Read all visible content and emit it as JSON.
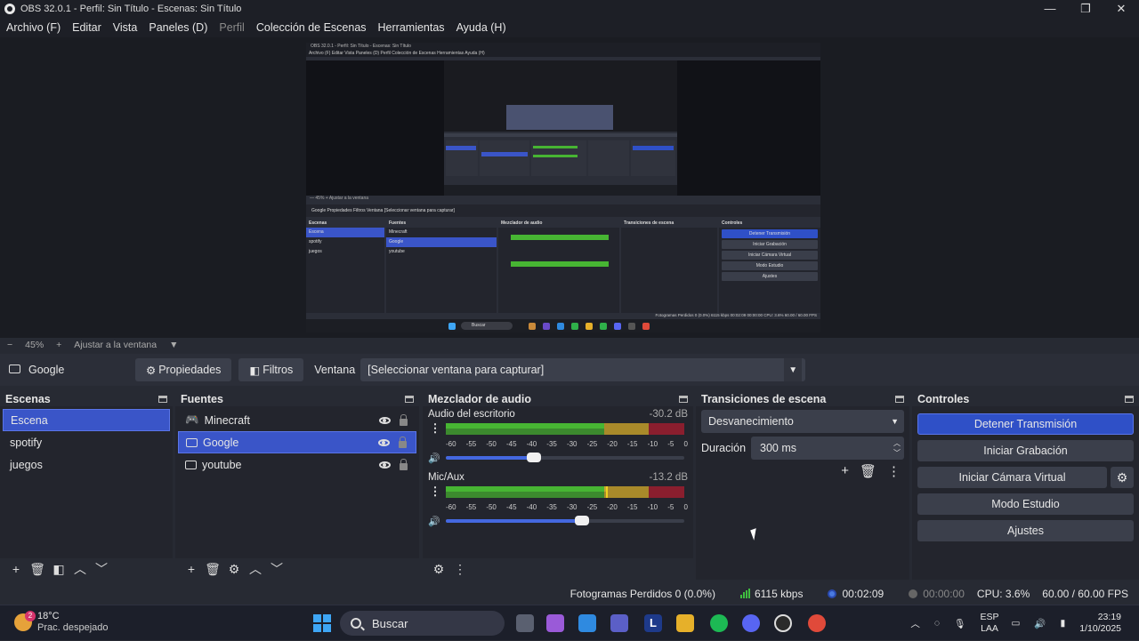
{
  "window": {
    "title": "OBS 32.0.1 - Perfil: Sin Título - Escenas: Sin Título",
    "minimize": "—",
    "maximize": "❐",
    "close": "✕"
  },
  "menu": [
    "Archivo (F)",
    "Editar",
    "Vista",
    "Paneles (D)",
    "Perfil",
    "Colección de Escenas",
    "Herramientas",
    "Ayuda (H)"
  ],
  "nested_preview": {
    "title": "OBS 32.0.1 - Perfil: Sin Título - Escenas: Sin Título",
    "menu": "Archivo (F)   Editar   Vista   Paneles (D)   Perfil   Colección de Escenas   Herramientas   Ayuda (H)",
    "zoom": "— 45%  +  Ajustar a la ventana",
    "source_bar": "Google        Propiedades   Filtros   Ventana  [Seleccionar ventana para capturar]",
    "scenes": [
      "Escena",
      "spotify",
      "juegos"
    ],
    "sources": [
      "Minecraft",
      "Google",
      "youtube"
    ],
    "controls": [
      "Detener Transmisión",
      "Iniciar Grabación",
      "Iniciar Cámara Virtual",
      "Modo Estudio",
      "Ajustes"
    ],
    "status": "Fotogramas Perdidos 0 (0.0%)   6115 kbps   00:02:09   00:00:00   CPU: 3.6%   60.00 / 60.00 FPS",
    "search": "Buscar"
  },
  "zoom": {
    "minus": "−",
    "level": "45%",
    "plus": "+",
    "fit": "Ajustar a la ventana",
    "caret": "▼"
  },
  "source_toolbar": {
    "name": "Google",
    "properties": "Propiedades",
    "filters": "Filtros",
    "window_label": "Ventana",
    "window_value": "[Seleccionar ventana para capturar]"
  },
  "scenes": {
    "title": "Escenas",
    "items": [
      "Escena",
      "spotify",
      "juegos"
    ],
    "selected": 0
  },
  "sources": {
    "title": "Fuentes",
    "items": [
      {
        "name": "Minecraft",
        "icon": "gamepad-icon"
      },
      {
        "name": "Google",
        "icon": "window-icon"
      },
      {
        "name": "youtube",
        "icon": "monitor-icon"
      }
    ],
    "selected": 1
  },
  "mixer": {
    "title": "Mezclador de audio",
    "channels": [
      {
        "name": "Audio del escritorio",
        "db": "-30.2 dB",
        "volume": 0.37
      },
      {
        "name": "Mic/Aux",
        "db": "-13.2 dB",
        "volume": 0.57
      }
    ],
    "ticks": [
      "-60",
      "-55",
      "-50",
      "-45",
      "-40",
      "-35",
      "-30",
      "-25",
      "-20",
      "-15",
      "-10",
      "-5",
      "0"
    ]
  },
  "transitions": {
    "title": "Transiciones de escena",
    "type": "Desvanecimiento",
    "duration_label": "Duración",
    "duration_value": "300 ms"
  },
  "controls": {
    "title": "Controles",
    "stop_stream": "Detener Transmisión",
    "start_record": "Iniciar Grabación",
    "start_vcam": "Iniciar Cámara Virtual",
    "studio": "Modo Estudio",
    "settings": "Ajustes"
  },
  "status": {
    "dropped": "Fotogramas Perdidos 0 (0.0%)",
    "bitrate": "6115 kbps",
    "stream_time": "00:02:09",
    "rec_time": "00:00:00",
    "cpu": "CPU: 3.6%",
    "fps": "60.00 / 60.00 FPS"
  },
  "taskbar": {
    "temp": "18°C",
    "weather": "Prac. despejado",
    "weather_badge": "2",
    "search": "Buscar",
    "lang1": "ESP",
    "lang2": "LAA",
    "time": "23:19",
    "date": "1/10/2025"
  },
  "colors": {
    "accent": "#2f50c7",
    "selection": "#3a55c8",
    "meter_green": "#47b533",
    "meter_yellow": "#c5a532",
    "meter_red": "#8a1e2e"
  }
}
